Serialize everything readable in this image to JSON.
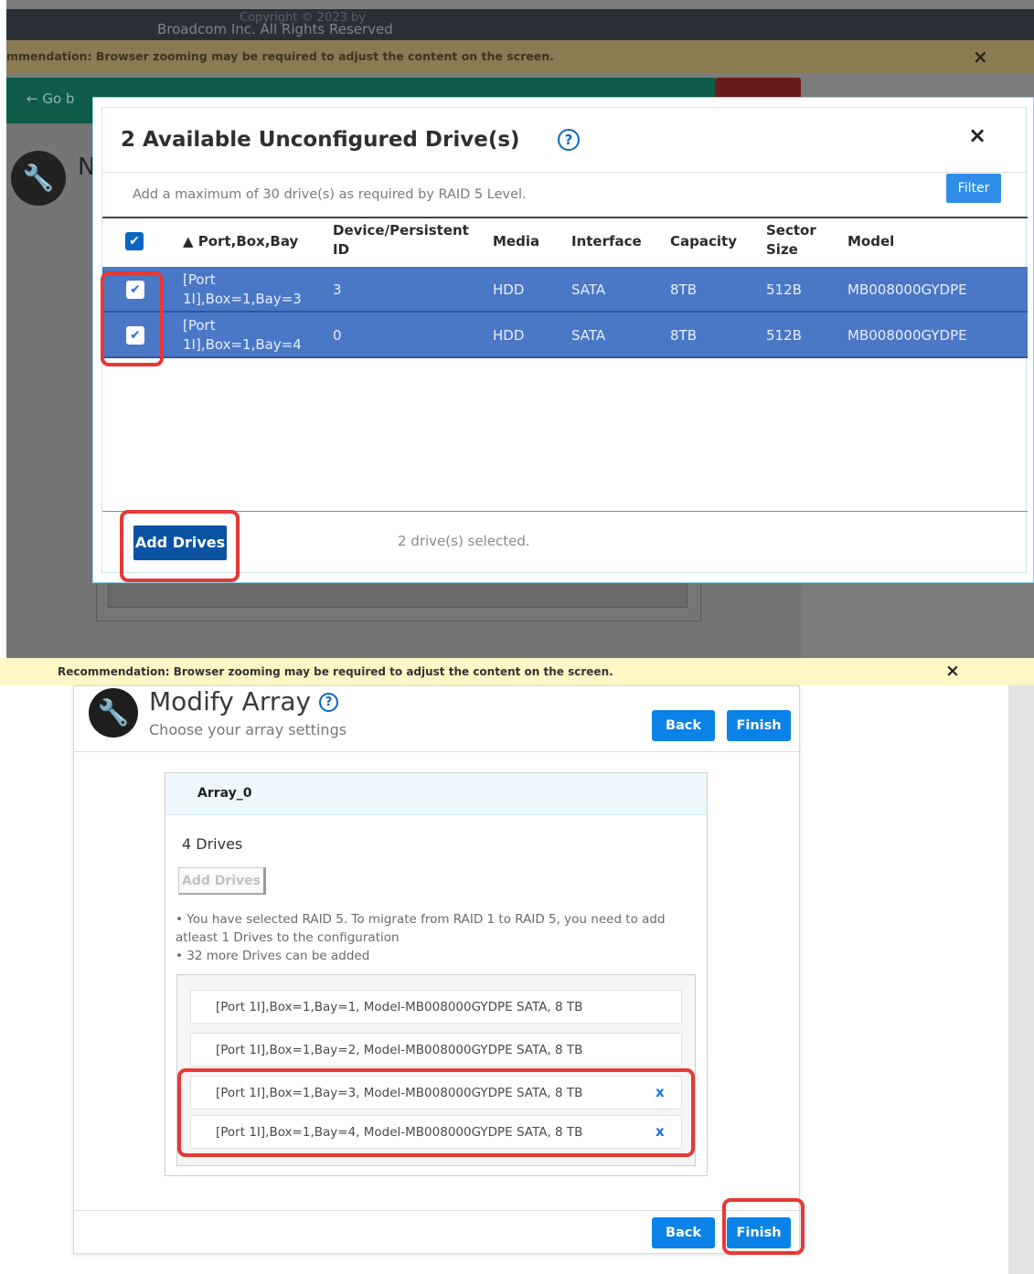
{
  "top": {
    "copyright_line1": "Copyright © 2023 by",
    "copyright_line2": "Broadcom Inc. All Rights Reserved",
    "recommendation": "mmendation: Browser zooming may be required to adjust the content on the screen.",
    "recommendation_close": "×",
    "go_back": "←  Go b",
    "bg_icon": "🔧",
    "bg_letter": "N",
    "modal": {
      "title": "2 Available Unconfigured Drive(s)",
      "help_icon": "?",
      "close": "×",
      "hint": "Add a maximum of 30 drive(s) as required by RAID 5 Level.",
      "filter_label": "Filter",
      "header_checkbox": "✔",
      "columns": [
        "▲  Port,Box,Bay",
        "Device/Persistent ID",
        "Media",
        "Interface",
        "Capacity",
        "Sector Size",
        "Model"
      ],
      "rows": [
        {
          "check": "✔",
          "port_line1": "[Port",
          "port_line2": "1I],Box=1,Bay=3",
          "id": "3",
          "media": "HDD",
          "interface": "SATA",
          "capacity": "8TB",
          "sector": "512B",
          "model": "MB008000GYDPE"
        },
        {
          "check": "✔",
          "port_line1": "[Port",
          "port_line2": "1I],Box=1,Bay=4",
          "id": "0",
          "media": "HDD",
          "interface": "SATA",
          "capacity": "8TB",
          "sector": "512B",
          "model": "MB008000GYDPE"
        }
      ],
      "add_drives_label": "Add Drives",
      "selected_text": "2 drive(s) selected."
    }
  },
  "bottom": {
    "recommendation": "Recommendation: Browser zooming may be required to adjust the content on the screen.",
    "recommendation_close": "×",
    "wrench_icon": "🔧",
    "title": "Modify Array",
    "help_icon": "?",
    "subtitle": "Choose your array settings",
    "back_label": "Back",
    "finish_label": "Finish",
    "array": {
      "name": "Array_0",
      "drive_count": "4  Drives",
      "add_drives_label": "Add Drives",
      "note1": "• You have selected RAID 5. To migrate from RAID 1 to RAID 5, you need to add",
      "note2": "atleast 1 Drives to the configuration",
      "note3": "• 32 more Drives can be added",
      "drives": [
        {
          "text": "[Port 1I],Box=1,Bay=1, Model-MB008000GYDPE SATA, 8 TB",
          "remove": ""
        },
        {
          "text": "[Port 1I],Box=1,Bay=2, Model-MB008000GYDPE SATA, 8 TB",
          "remove": ""
        },
        {
          "text": "[Port 1I],Box=1,Bay=3, Model-MB008000GYDPE SATA, 8 TB",
          "remove": "x"
        },
        {
          "text": "[Port 1I],Box=1,Bay=4, Model-MB008000GYDPE SATA, 8 TB",
          "remove": "x"
        }
      ]
    }
  },
  "colors": {
    "primary_blue": "#0b82e8",
    "selected_row": "#4a78c6",
    "highlight_red": "#e53935",
    "recommendation_yellow": "#fdf7c5"
  }
}
